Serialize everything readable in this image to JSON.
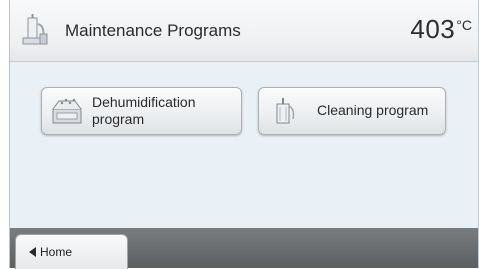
{
  "header": {
    "title": "Maintenance Programs",
    "temperature": "403",
    "temperature_unit": "°C",
    "icon": "maintenance-icon"
  },
  "programs": [
    {
      "label": "Dehumidification\nprogram",
      "icon": "dehumidification-icon"
    },
    {
      "label": "Cleaning program",
      "icon": "cleaning-icon"
    }
  ],
  "footer": {
    "home_label": "Home",
    "home_icon": "back-arrow-icon"
  },
  "colors": {
    "background": "#eaf1f6",
    "footer": "#676a6d",
    "text": "#2c2c2c"
  }
}
